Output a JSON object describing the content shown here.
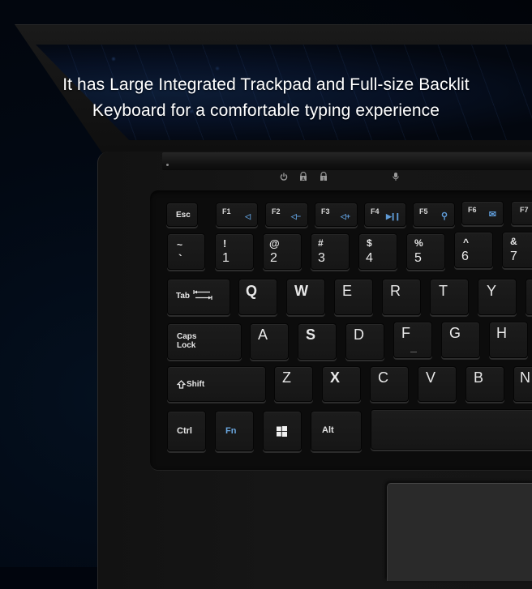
{
  "headline": {
    "line1": "It has Large Integrated Trackpad and Full-size Backlit",
    "line2": "Keyboard for a comfortable typing experience"
  },
  "colors": {
    "background": "#01050d",
    "fn_accent": "#6aa7e0",
    "key_legend": "#e8e8e8",
    "trackpad": "#2a2a2a"
  },
  "indicators": [
    {
      "name": "power-icon",
      "glyph": "power"
    },
    {
      "name": "caps-lock-icon",
      "glyph": "lock-A"
    },
    {
      "name": "num-lock-icon",
      "glyph": "lock-1"
    },
    {
      "name": "microphone-icon",
      "glyph": "mic"
    }
  ],
  "keyboard": {
    "function_row": [
      {
        "label": "Esc"
      },
      {
        "label": "F1",
        "icon": "mute-icon",
        "glyph": "◁"
      },
      {
        "label": "F2",
        "icon": "volume-down-icon",
        "glyph": "◁−"
      },
      {
        "label": "F3",
        "icon": "volume-up-icon",
        "glyph": "◁+"
      },
      {
        "label": "F4",
        "icon": "play-pause-icon",
        "glyph": "▶❙❙"
      },
      {
        "label": "F5",
        "icon": "search-icon",
        "glyph": "⚲"
      },
      {
        "label": "F6",
        "icon": "mail-icon",
        "glyph": "✉"
      },
      {
        "label": "F7"
      }
    ],
    "number_row": [
      {
        "top": "~",
        "bottom": "`"
      },
      {
        "top": "!",
        "bottom": "1"
      },
      {
        "top": "@",
        "bottom": "2"
      },
      {
        "top": "#",
        "bottom": "3"
      },
      {
        "top": "$",
        "bottom": "4"
      },
      {
        "top": "%",
        "bottom": "5"
      },
      {
        "top": "^",
        "bottom": "6"
      },
      {
        "top": "&",
        "bottom": "7"
      }
    ],
    "qwerty_row": {
      "tab": "Tab",
      "keys": [
        "Q",
        "W",
        "E",
        "R",
        "T",
        "Y",
        ""
      ]
    },
    "home_row": {
      "caps_line1": "Caps",
      "caps_line2": "Lock",
      "keys": [
        "A",
        "S",
        "D",
        "F",
        "G",
        "H"
      ]
    },
    "shift_row": {
      "shift": "Shift",
      "keys": [
        "Z",
        "X",
        "C",
        "V",
        "B",
        "N"
      ]
    },
    "bottom_row": {
      "ctrl": "Ctrl",
      "fn": "Fn",
      "win": "windows-logo",
      "alt": "Alt",
      "space": ""
    }
  }
}
